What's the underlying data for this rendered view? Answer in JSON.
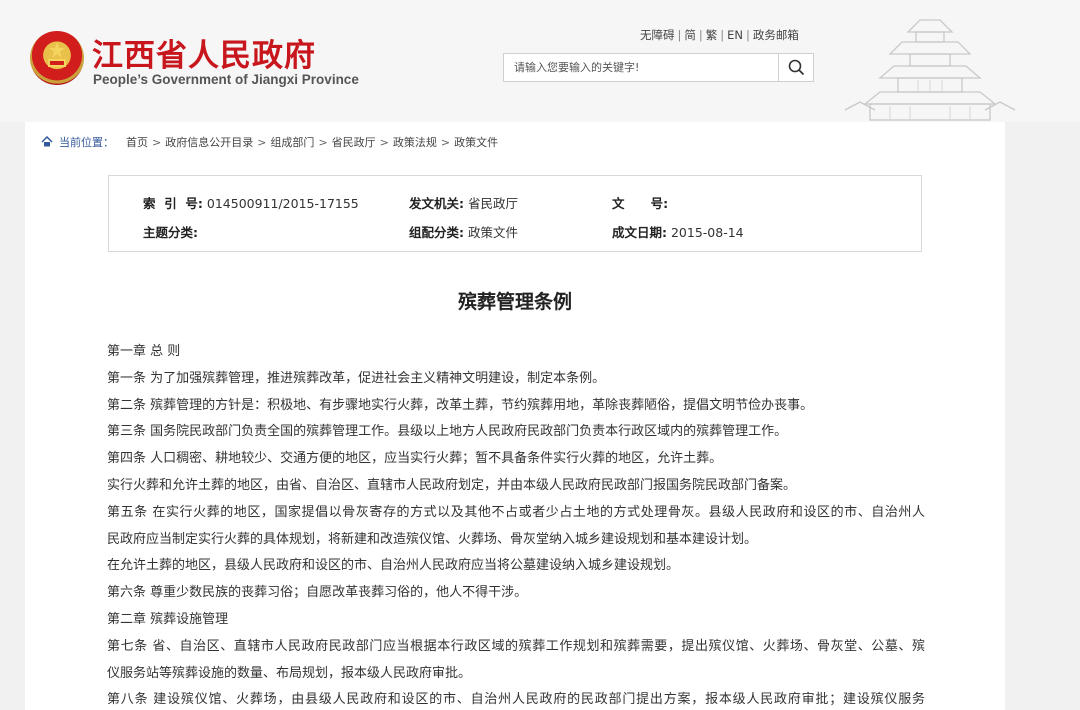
{
  "header": {
    "site_title_cn": "江西省人民政府",
    "site_title_en": "People’s Government of Jiangxi Province",
    "top_links": [
      "无障碍",
      "简",
      "繁",
      "EN",
      "政务邮箱"
    ],
    "search": {
      "placeholder": "请输入您要输入的关键字!"
    }
  },
  "breadcrumb": {
    "label": "当前位置：",
    "items": [
      "首页",
      "政府信息公开目录",
      "组成部门",
      "省民政厅",
      "政策法规",
      "政策文件"
    ],
    "separator": ">"
  },
  "meta": {
    "index_label": "索  引  号:",
    "index_value": "014500911/2015-17155",
    "issuer_label": "发文机关:",
    "issuer_value": "省民政厅",
    "docno_label": "文      号:",
    "docno_value": "",
    "topic_label": "主题分类:",
    "topic_value": "",
    "group_label": "组配分类:",
    "group_value": "政策文件",
    "date_label": "成文日期:",
    "date_value": "2015-08-14"
  },
  "document": {
    "title": "殡葬管理条例",
    "lines": [
      "第一章 总 则",
      "第一条 为了加强殡葬管理，推进殡葬改革，促进社会主义精神文明建设，制定本条例。",
      "第二条 殡葬管理的方针是：积极地、有步骤地实行火葬，改革土葬，节约殡葬用地，革除丧葬陋俗，提倡文明节俭办丧事。",
      "第三条 国务院民政部门负责全国的殡葬管理工作。县级以上地方人民政府民政部门负责本行政区域内的殡葬管理工作。",
      "第四条 人口稠密、耕地较少、交通方便的地区，应当实行火葬；暂不具备条件实行火葬的地区，允许土葬。",
      "实行火葬和允许土葬的地区，由省、自治区、直辖市人民政府划定，并由本级人民政府民政部门报国务院民政部门备案。",
      "第五条 在实行火葬的地区，国家提倡以骨灰寄存的方式以及其他不占或者少占土地的方式处理骨灰。县级人民政府和设区的市、自治州人",
      "民政府应当制定实行火葬的具体规划，将新建和改造殡仪馆、火葬场、骨灰堂纳入城乡建设规划和基本建设计划。",
      "在允许土葬的地区，县级人民政府和设区的市、自治州人民政府应当将公墓建设纳入城乡建设规划。",
      "第六条 尊重少数民族的丧葬习俗；自愿改革丧葬习俗的，他人不得干涉。",
      "第二章 殡葬设施管理",
      "第七条 省、自治区、直辖市人民政府民政部门应当根据本行政区域的殡葬工作规划和殡葬需要，提出殡仪馆、火葬场、骨灰堂、公墓、殡",
      "仪服务站等殡葬设施的数量、布局规划，报本级人民政府审批。",
      "第八条 建设殡仪馆、火葬场，由县级人民政府和设区的市、自治州人民政府的民政部门提出方案，报本级人民政府审批；建设殡仪服务"
    ]
  }
}
